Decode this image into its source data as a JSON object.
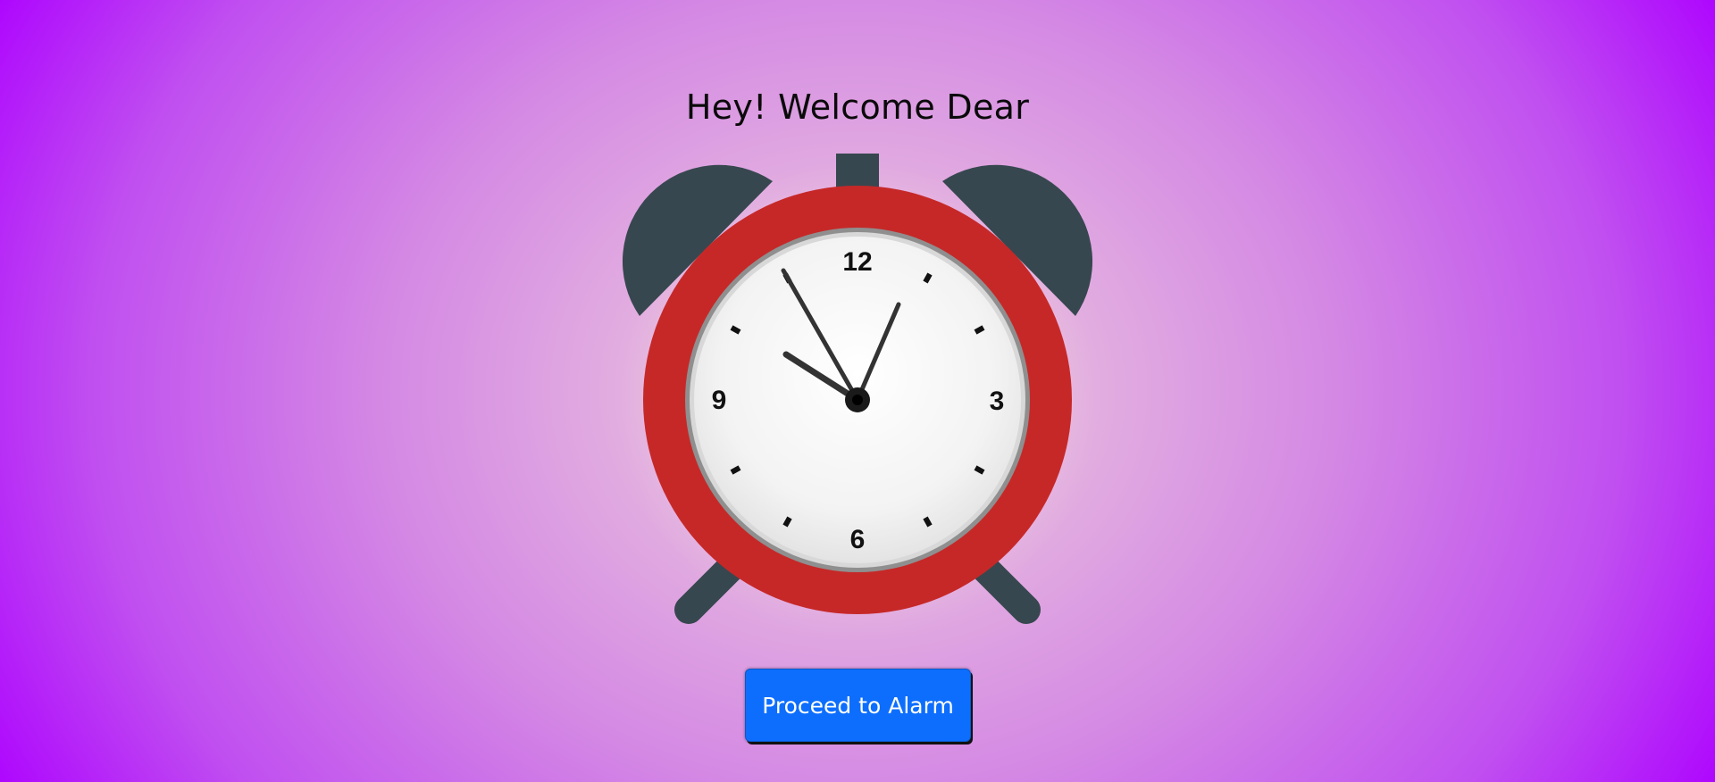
{
  "page": {
    "title": "Hey! Welcome Dear"
  },
  "clock": {
    "time_shown": "10:05:55",
    "numerals": {
      "twelve": "12",
      "three": "3",
      "six": "6",
      "nine": "9"
    },
    "colors": {
      "frame": "#c62828",
      "bells": "#37474f",
      "face": "#f4f4f4",
      "hands": "#333333"
    }
  },
  "actions": {
    "proceed_label": "Proceed to Alarm",
    "button_color": "#0d6efd"
  }
}
